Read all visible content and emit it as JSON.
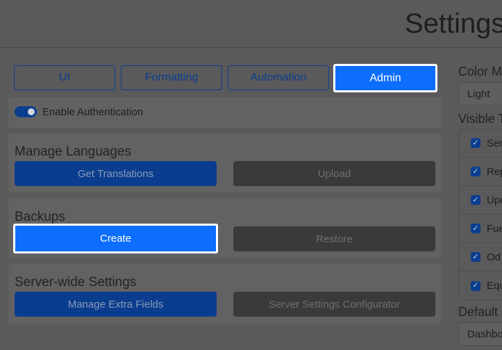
{
  "page": {
    "title": "Settings"
  },
  "tabs": [
    {
      "label": "UI",
      "active": false
    },
    {
      "label": "Formatting",
      "active": false
    },
    {
      "label": "Automation",
      "active": false
    },
    {
      "label": "Admin",
      "active": true
    }
  ],
  "authentication": {
    "label": "Enable Authentication",
    "enabled": true
  },
  "sections": {
    "languages": {
      "title": "Manage Languages",
      "primary": "Get Translations",
      "secondary": "Upload"
    },
    "backups": {
      "title": "Backups",
      "primary": "Create",
      "secondary": "Restore"
    },
    "server": {
      "title": "Server-wide Settings",
      "primary": "Manage Extra Fields",
      "secondary": "Server Settings Configurator"
    }
  },
  "side": {
    "color_mode_label": "Color M",
    "color_mode_value": "Light",
    "visible_label": "Visible T",
    "visible_items": [
      "Ser",
      "Rep",
      "Upc",
      "Fue",
      "Od",
      "Equ"
    ],
    "default_label": "Default",
    "default_value": "Dashbo"
  },
  "colors": {
    "accent": "#0d6efd",
    "accent_dark": "#0b3d8e",
    "overlay_bg": "#5a5a5a"
  }
}
